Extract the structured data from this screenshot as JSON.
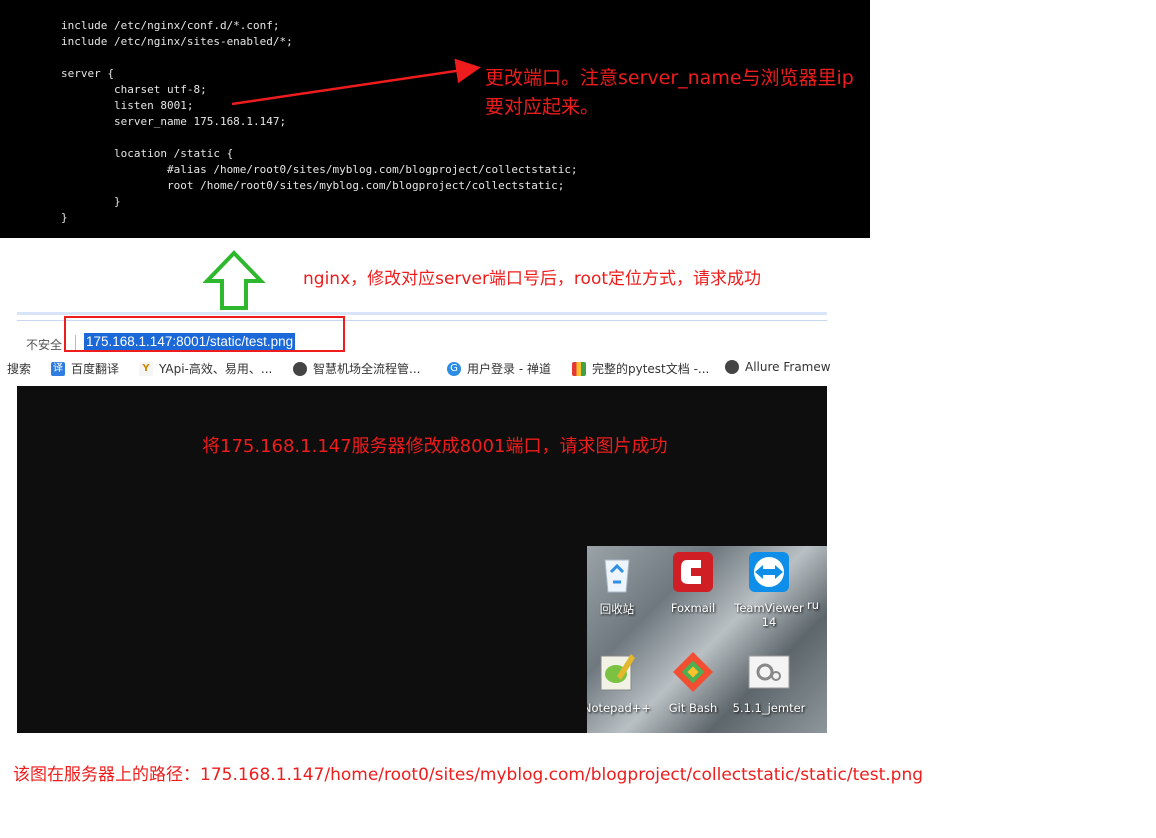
{
  "terminal": {
    "lines": [
      "include /etc/nginx/conf.d/*.conf;",
      "include /etc/nginx/sites-enabled/*;",
      "",
      "server {",
      "        charset utf-8;",
      "        listen 8001;",
      "        server_name 175.168.1.147;",
      "",
      "        location /static {",
      "                #alias /home/root0/sites/myblog.com/blogproject/collectstatic;",
      "                root /home/root0/sites/myblog.com/blogproject/collectstatic;",
      "        }",
      "}"
    ]
  },
  "annotations": {
    "top": "更改端口。注意server_name与浏览器里ip要对应起来。",
    "middle": "nginx，修改对应server端口号后，root定位方式，请求成功",
    "image": "将175.168.1.147服务器修改成8001端口，请求图片成功",
    "bottom": "该图在服务器上的路径：175.168.1.147/home/root0/sites/myblog.com/blogproject/collectstatic/static/test.png"
  },
  "browser": {
    "insecure_label": "不安全",
    "url": "175.168.1.147:8001/static/test.png",
    "bookmarks": [
      {
        "label": "搜索",
        "icon": "search-icon"
      },
      {
        "label": "百度翻译",
        "icon": "translate-icon"
      },
      {
        "label": "YApi-高效、易用、...",
        "icon": "yapi-icon"
      },
      {
        "label": "智慧机场全流程管...",
        "icon": "globe-icon"
      },
      {
        "label": "用户登录 - 禅道",
        "icon": "zentao-icon"
      },
      {
        "label": "完整的pytest文档 -...",
        "icon": "pytest-icon"
      },
      {
        "label": "Allure Framew",
        "icon": "globe-icon"
      }
    ]
  },
  "desktop": {
    "icons": [
      {
        "label": "回收站",
        "icon": "recycle-bin-icon"
      },
      {
        "label": "Foxmail",
        "icon": "foxmail-icon"
      },
      {
        "label": "TeamViewer 14",
        "icon": "teamviewer-icon"
      },
      {
        "label": "ru",
        "icon": "partial-icon"
      },
      {
        "label": "Notepad++",
        "icon": "notepad-plus-plus-icon"
      },
      {
        "label": "Git Bash",
        "icon": "git-bash-icon"
      },
      {
        "label": "5.1.1_jemter",
        "icon": "jmeter-shortcut-icon"
      }
    ]
  },
  "colors": {
    "annotation_red": "#ee1c1c",
    "arrow_green": "#2eb82e",
    "url_highlight": "#1b68d8"
  }
}
